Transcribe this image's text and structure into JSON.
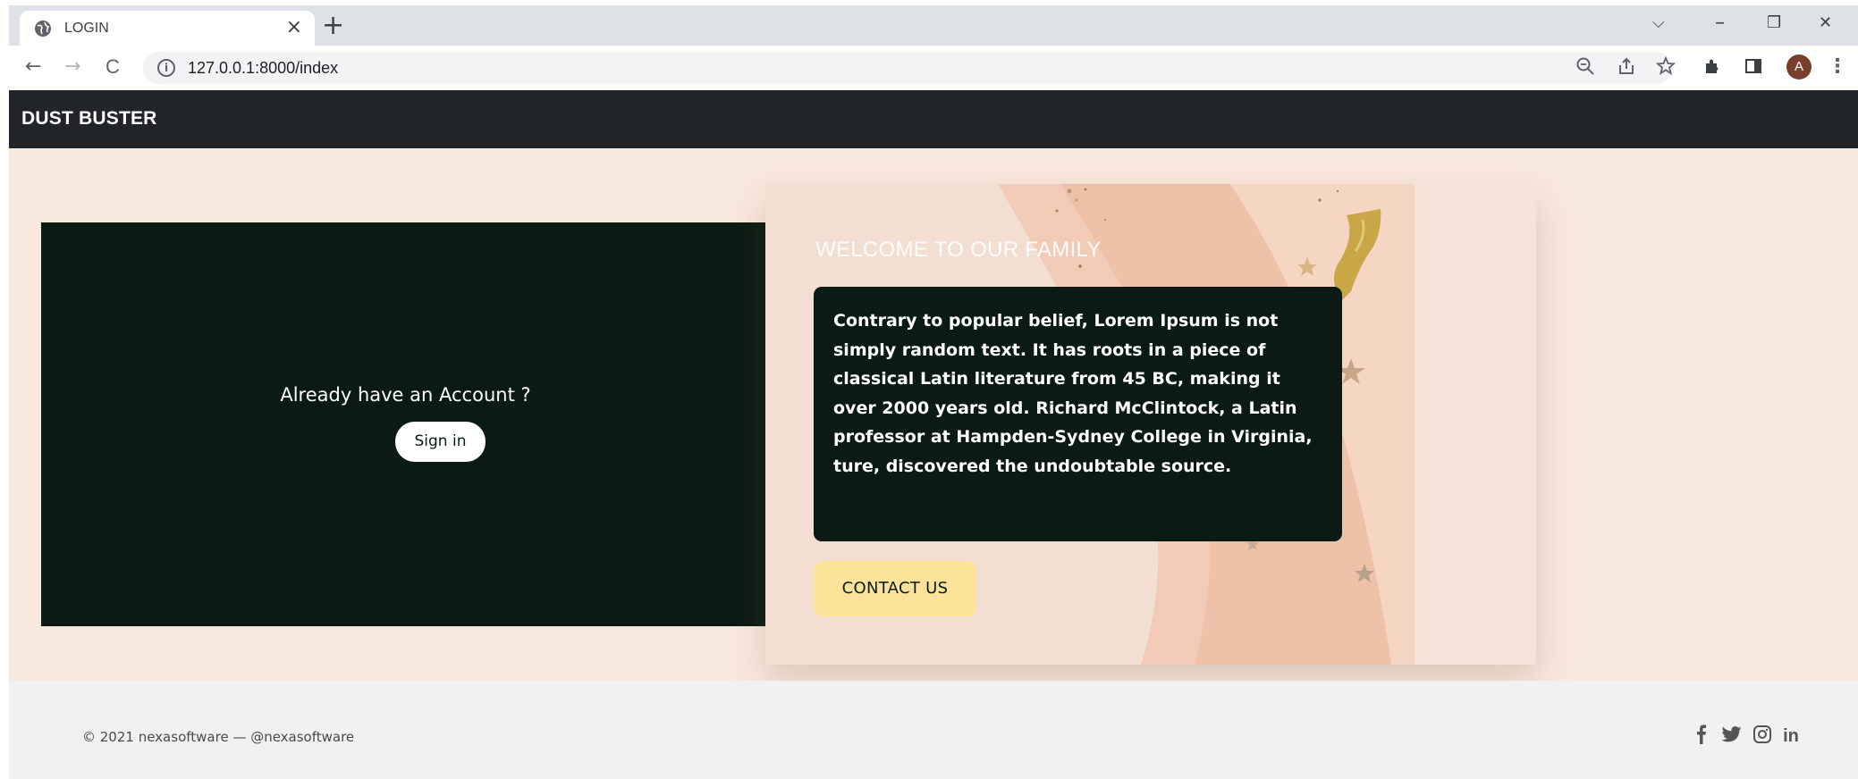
{
  "browser": {
    "tab_title": "LOGIN",
    "tab_close": "×",
    "new_tab": "+",
    "url": "127.0.0.1:8000/index",
    "avatar_initial": "A",
    "controls": {
      "tab_search": "⌵",
      "minimize": "–",
      "maximize": "❐",
      "close": "✕"
    },
    "nav": {
      "back": "←",
      "forward": "→",
      "reload": "C"
    }
  },
  "navbar": {
    "brand": "DUST BUSTER"
  },
  "left_panel": {
    "prompt": "Already have an Account ?",
    "signin_label": "Sign in"
  },
  "right_card": {
    "heading": "WELCOME TO OUR FAMILY",
    "body": "Contrary to popular belief, Lorem Ipsum is not simply random text. It has roots in a piece of classical Latin literature from 45 BC, making it over 2000 years old. Richard McClintock, a Latin professor at Hampden-Sydney College in Virginia, ture, discovered the undoubtable source.",
    "contact_label": "CONTACT US"
  },
  "footer": {
    "copyright": "© 2021 nexasoftware — @nexasoftware",
    "social": [
      "facebook-icon",
      "twitter-icon",
      "instagram-icon",
      "linkedin-icon"
    ]
  },
  "colors": {
    "navbar": "#212529",
    "page_bg": "#f9e8dd",
    "dark_panel": "#0b1b14",
    "contact_button": "#fde39a",
    "footer_bg": "#f0f1f2"
  }
}
